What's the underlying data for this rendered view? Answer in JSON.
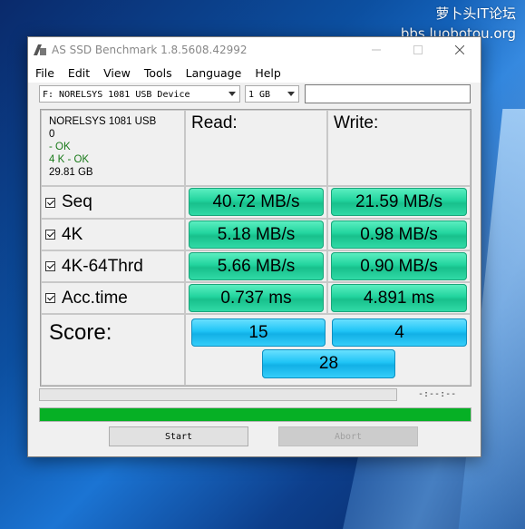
{
  "watermark": {
    "line1": "萝卜头IT论坛",
    "line2": "bbs.luobotou.org"
  },
  "window": {
    "title": "AS SSD Benchmark 1.8.5608.42992"
  },
  "menu": [
    "File",
    "Edit",
    "View",
    "Tools",
    "Language",
    "Help"
  ],
  "toolbar": {
    "drive": "F: NORELSYS 1081 USB Device",
    "size": "1 GB"
  },
  "info": {
    "device": "NORELSYS 1081 USB",
    "line2": "0",
    "status1": " - OK",
    "status2": "4 K - OK",
    "capacity": "29.81 GB"
  },
  "headers": {
    "read": "Read:",
    "write": "Write:"
  },
  "rows": [
    {
      "label": "Seq",
      "read": "40.72 MB/s",
      "write": "21.59 MB/s"
    },
    {
      "label": "4K",
      "read": "5.18 MB/s",
      "write": "0.98 MB/s"
    },
    {
      "label": "4K-64Thrd",
      "read": "5.66 MB/s",
      "write": "0.90 MB/s"
    },
    {
      "label": "Acc.time",
      "read": "0.737 ms",
      "write": "4.891 ms"
    }
  ],
  "score": {
    "label": "Score:",
    "read": "15",
    "write": "4",
    "total": "28"
  },
  "progress": {
    "time": "-:--:--",
    "bar_fill_fraction": 1.0
  },
  "buttons": {
    "start": "Start",
    "abort": "Abort"
  },
  "colors": {
    "value_green": "#22d49e",
    "score_blue": "#1fc4f6",
    "progress_green": "#06b025"
  }
}
